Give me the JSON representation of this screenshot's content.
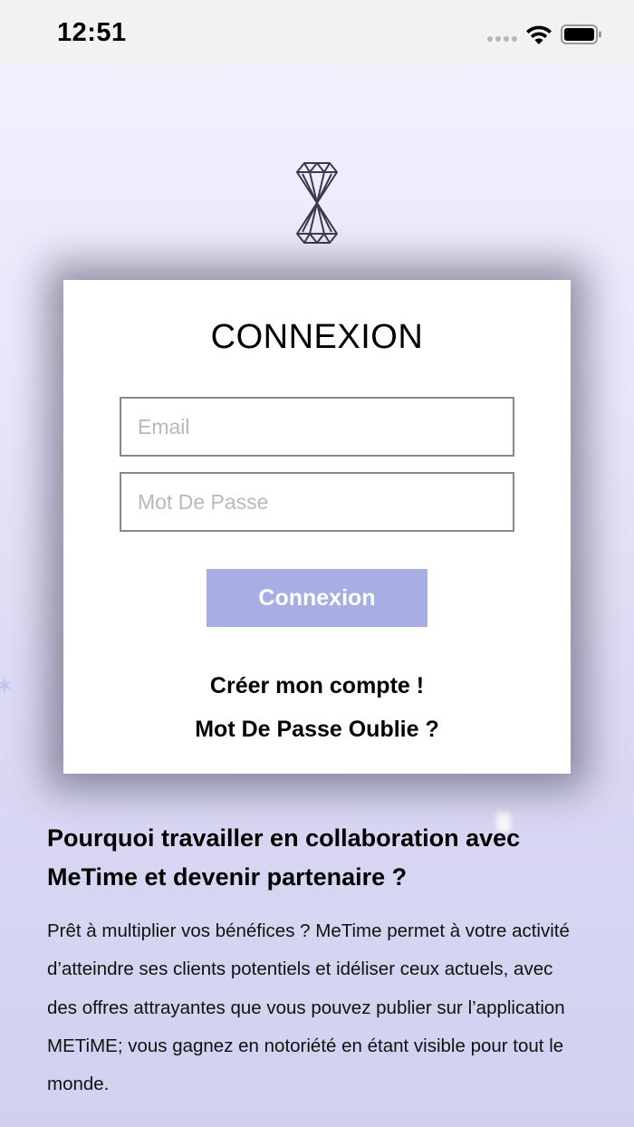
{
  "status_bar": {
    "time": "12:51"
  },
  "login": {
    "title": "CONNEXION",
    "email_placeholder": "Email",
    "password_placeholder": "Mot De Passe",
    "submit_label": "Connexion",
    "create_account_link": "Créer mon compte !",
    "forgot_password_link": "Mot De Passe Oublie ?"
  },
  "info": {
    "heading": "Pourquoi travailler en collaboration avec MeTime et devenir partenaire ?",
    "body": "Prêt à multiplier vos bénéfices ? MeTime permet à votre activité d’atteindre ses clients potentiels et idéliser ceux actuels, avec des offres attrayantes que vous pouvez publier sur l’application METiME; vous gagnez en notoriété en étant visible pour tout le monde."
  },
  "colors": {
    "accent_button": "#a6aee2",
    "background_top": "#f3effd",
    "background_bottom": "#cfd1ef"
  },
  "icons": {
    "logo": "hourglass-diamond-logo",
    "signal": "cellular-signal-icon",
    "wifi": "wifi-icon",
    "battery": "battery-icon"
  }
}
